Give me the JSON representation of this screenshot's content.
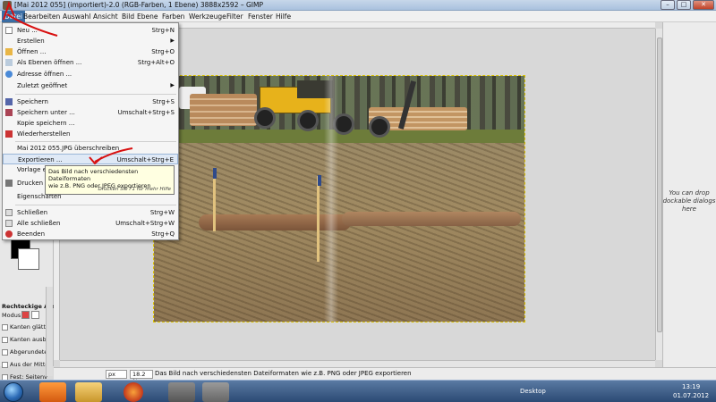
{
  "window": {
    "title": "[Mai 2012 055] (importiert)-2.0 (RGB-Farben, 1 Ebene) 3888x2592 – GIMP",
    "minimize": "–",
    "maximize": "□",
    "close": "✕"
  },
  "menubar": [
    "Datei",
    "Bearbeiten",
    "Auswahl",
    "Ansicht",
    "Bild",
    "Ebene",
    "Farben",
    "Werkzeuge",
    "Filter",
    "Fenster",
    "Hilfe"
  ],
  "file_menu": {
    "new": {
      "label": "Neu ...",
      "shortcut": "Strg+N"
    },
    "create": {
      "label": "Erstellen"
    },
    "open": {
      "label": "Öffnen ...",
      "shortcut": "Strg+O"
    },
    "open_as_layers": {
      "label": "Als Ebenen öffnen ...",
      "shortcut": "Strg+Alt+O"
    },
    "open_location": {
      "label": "Adresse öffnen ..."
    },
    "recent": {
      "label": "Zuletzt geöffnet"
    },
    "save": {
      "label": "Speichern",
      "shortcut": "Strg+S"
    },
    "save_as": {
      "label": "Speichern unter ...",
      "shortcut": "Umschalt+Strg+S"
    },
    "save_copy": {
      "label": "Kopie speichern ..."
    },
    "revert": {
      "label": "Wiederherstellen"
    },
    "overwrite": {
      "label": "Mai 2012 055.JPG überschreiben"
    },
    "export": {
      "label": "Exportieren ...",
      "shortcut": "Umschalt+Strg+E"
    },
    "templates": {
      "label": "Vorlage erst"
    },
    "print": {
      "label": "Drucken ..."
    },
    "properties": {
      "label": "Eigenschaften"
    },
    "close": {
      "label": "Schließen",
      "shortcut": "Strg+W"
    },
    "close_all": {
      "label": "Alle schließen",
      "shortcut": "Umschalt+Strg+W"
    },
    "quit": {
      "label": "Beenden",
      "shortcut": "Strg+Q"
    }
  },
  "tooltip": {
    "line1": "Das Bild nach verschiedensten Dateiformaten",
    "line2": "wie z.B. PNG oder JPEG exportieren",
    "hint": "Drücken Sie F1 für mehr Hilfe"
  },
  "tool_options": {
    "title": "Rechteckige Auswahl",
    "mode": "Modus:",
    "options": [
      "Kanten glätte",
      "Kanten ausbl",
      "Abgerundete",
      "Aus der Mitte",
      "Fest: Seitenv"
    ]
  },
  "dock_hint": "You can drop dockable dialogs here",
  "statusbar": {
    "unit": "px",
    "zoom": "18.2 %",
    "message": "Das Bild nach verschiedensten Dateiformaten wie z.B. PNG oder JPEG exportieren"
  },
  "taskbar": {
    "desktop": "Desktop",
    "time": "13:19",
    "date": "01.07.2012"
  },
  "icons": {
    "start": "windows-start-icon",
    "apps": [
      "media-player-icon",
      "explorer-icon",
      "firefox-icon",
      "gimp-icon",
      "gimp-image-icon"
    ]
  }
}
